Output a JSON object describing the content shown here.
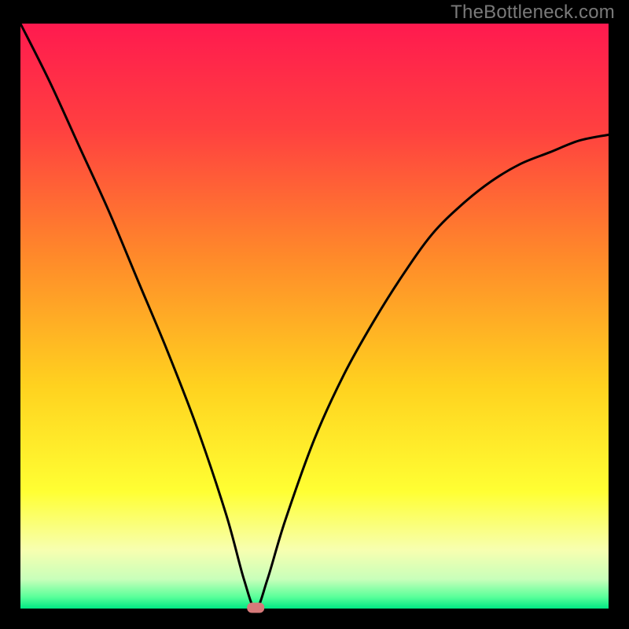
{
  "watermark": "TheBottleneck.com",
  "chart_data": {
    "type": "line",
    "title": "",
    "xlabel": "",
    "ylabel": "",
    "xlim": [
      0,
      100
    ],
    "ylim": [
      0,
      100
    ],
    "grid": false,
    "legend": false,
    "notes": "V-shaped bottleneck curve on a vertical red-to-green gradient background. Minimum (zero) at x≈40. No axis ticks or labels are shown.",
    "x": [
      0,
      5,
      10,
      15,
      20,
      25,
      30,
      35,
      38,
      40,
      42,
      45,
      50,
      55,
      60,
      65,
      70,
      75,
      80,
      85,
      90,
      95,
      100
    ],
    "values": [
      100,
      90,
      79,
      68,
      56,
      44,
      31,
      16,
      5,
      0,
      5,
      15,
      29,
      40,
      49,
      57,
      64,
      69,
      73,
      76,
      78,
      80,
      81
    ],
    "marker": {
      "x": 40,
      "y": 0
    },
    "gradient_stops": [
      {
        "pos": 0.0,
        "color": "#ff1a4f"
      },
      {
        "pos": 0.18,
        "color": "#ff4040"
      },
      {
        "pos": 0.4,
        "color": "#ff8a2a"
      },
      {
        "pos": 0.62,
        "color": "#ffd21f"
      },
      {
        "pos": 0.8,
        "color": "#ffff33"
      },
      {
        "pos": 0.9,
        "color": "#f7ffb0"
      },
      {
        "pos": 0.95,
        "color": "#c8ffba"
      },
      {
        "pos": 0.98,
        "color": "#5aff9a"
      },
      {
        "pos": 1.0,
        "color": "#00e884"
      }
    ]
  },
  "colors": {
    "frame": "#000000",
    "curve": "#000000",
    "marker": "#d77a7a",
    "watermark": "#7a7a7a"
  }
}
